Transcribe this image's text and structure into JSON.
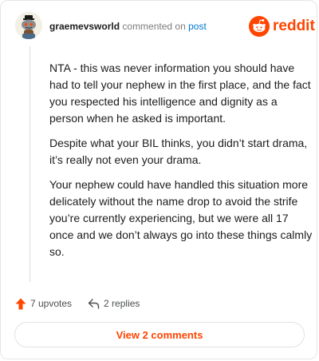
{
  "comment": {
    "username": "graemevsworld",
    "action_text": "commented on",
    "post_link": "post",
    "paragraphs": [
      "NTA - this was never information you should have had to tell your nephew in the first place, and the fact you respected his intelligence and dignity as a person when he asked is important.",
      "Despite what your BIL thinks, you didn’t start drama, it’s really not even your drama.",
      "Your nephew could have handled this situation more delicately without the name drop to avoid the strife you’re currently experiencing, but we were all 17 once and we don’t always go into these things calmly so."
    ],
    "upvotes_label": "7 upvotes",
    "replies_label": "2 replies"
  },
  "brand": {
    "name": "reddit",
    "color": "#ff4500"
  },
  "footer": {
    "view_comments_label": "View 2 comments"
  },
  "icons": {
    "avatar": "snoo-avatar",
    "logo": "reddit-snoo-icon",
    "upvote": "upvote-arrow-icon",
    "reply": "reply-arrow-icon"
  }
}
